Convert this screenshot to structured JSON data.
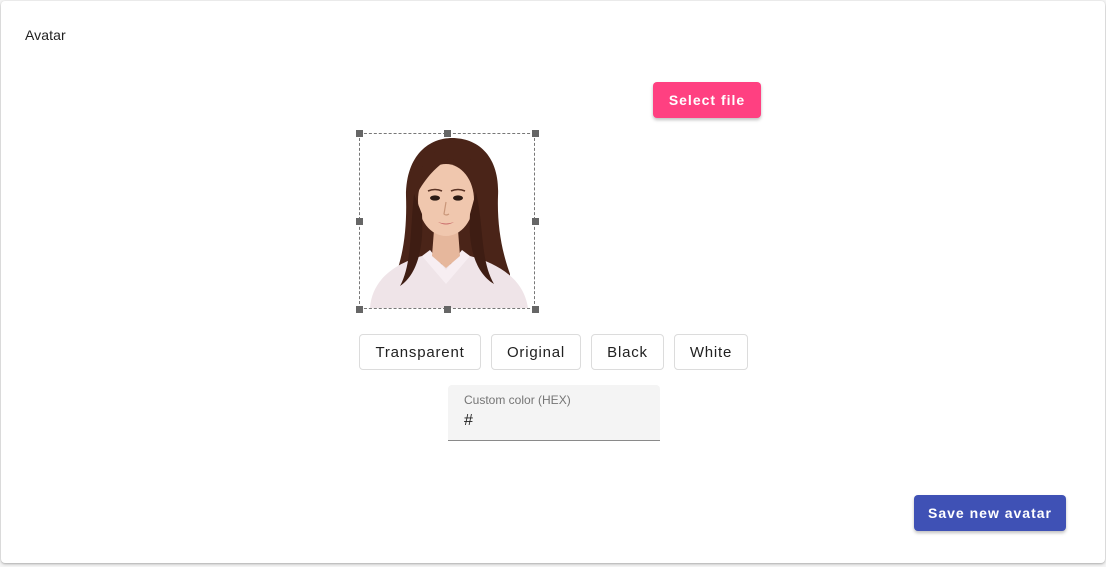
{
  "card": {
    "title": "Avatar"
  },
  "actions": {
    "select_file_label": "Select file",
    "save_label": "Save new avatar"
  },
  "background_options": [
    {
      "label": "Transparent"
    },
    {
      "label": "Original"
    },
    {
      "label": "Black"
    },
    {
      "label": "White"
    }
  ],
  "custom_color": {
    "label": "Custom color (HEX)",
    "prefix": "#",
    "value": ""
  },
  "avatar_image": {
    "description_icon": "portrait-photo"
  },
  "colors": {
    "accent_pink": "#ff4081",
    "primary_indigo": "#3f51b5"
  }
}
